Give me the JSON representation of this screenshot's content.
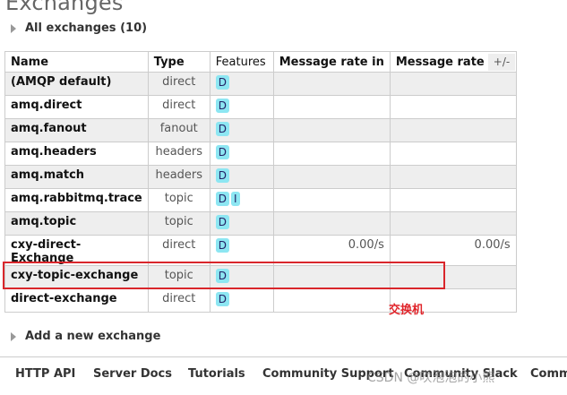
{
  "page": {
    "title": "Exchanges"
  },
  "section_all": {
    "label": "All exchanges (10)"
  },
  "table": {
    "headers": {
      "name": "Name",
      "type": "Type",
      "features": "Features",
      "rate_in": "Message rate in",
      "rate_out": "Message rate out"
    },
    "columns_toggle": "+/-",
    "rows": [
      {
        "name": "(AMQP default)",
        "type": "direct",
        "features": [
          "D"
        ],
        "rate_in": "",
        "rate_out": ""
      },
      {
        "name": "amq.direct",
        "type": "direct",
        "features": [
          "D"
        ],
        "rate_in": "",
        "rate_out": ""
      },
      {
        "name": "amq.fanout",
        "type": "fanout",
        "features": [
          "D"
        ],
        "rate_in": "",
        "rate_out": ""
      },
      {
        "name": "amq.headers",
        "type": "headers",
        "features": [
          "D"
        ],
        "rate_in": "",
        "rate_out": ""
      },
      {
        "name": "amq.match",
        "type": "headers",
        "features": [
          "D"
        ],
        "rate_in": "",
        "rate_out": ""
      },
      {
        "name": "amq.rabbitmq.trace",
        "type": "topic",
        "features": [
          "D",
          "I"
        ],
        "rate_in": "",
        "rate_out": ""
      },
      {
        "name": "amq.topic",
        "type": "topic",
        "features": [
          "D"
        ],
        "rate_in": "",
        "rate_out": ""
      },
      {
        "name": "cxy-direct-Exchange",
        "type": "direct",
        "features": [
          "D"
        ],
        "rate_in": "0.00/s",
        "rate_out": "0.00/s"
      },
      {
        "name": "cxy-topic-exchange",
        "type": "topic",
        "features": [
          "D"
        ],
        "rate_in": "",
        "rate_out": ""
      },
      {
        "name": "direct-exchange",
        "type": "direct",
        "features": [
          "D"
        ],
        "rate_in": "",
        "rate_out": ""
      }
    ]
  },
  "annotation": {
    "text": "交换机",
    "color": "#e0242a"
  },
  "section_add": {
    "label": "Add a new exchange"
  },
  "footer": {
    "links": [
      "HTTP API",
      "Server Docs",
      "Tutorials",
      "Community Support",
      "Community Slack",
      "Comm"
    ]
  },
  "watermark": {
    "text": "CSDN @吹泡泡的小熊"
  }
}
